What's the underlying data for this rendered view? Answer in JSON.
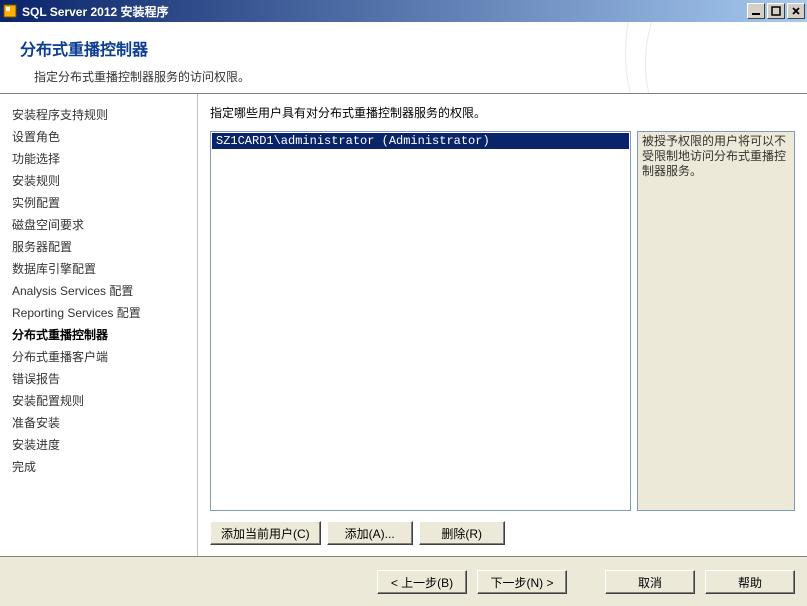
{
  "titlebar": {
    "title": "SQL Server 2012 安装程序"
  },
  "header": {
    "title": "分布式重播控制器",
    "subtitle": "指定分布式重播控制器服务的访问权限。"
  },
  "sidebar": {
    "items": [
      {
        "label": "安装程序支持规则",
        "active": false
      },
      {
        "label": "设置角色",
        "active": false
      },
      {
        "label": "功能选择",
        "active": false
      },
      {
        "label": "安装规则",
        "active": false
      },
      {
        "label": "实例配置",
        "active": false
      },
      {
        "label": "磁盘空间要求",
        "active": false
      },
      {
        "label": "服务器配置",
        "active": false
      },
      {
        "label": "数据库引擎配置",
        "active": false
      },
      {
        "label": "Analysis Services 配置",
        "active": false
      },
      {
        "label": "Reporting Services 配置",
        "active": false
      },
      {
        "label": "分布式重播控制器",
        "active": true
      },
      {
        "label": "分布式重播客户端",
        "active": false
      },
      {
        "label": "错误报告",
        "active": false
      },
      {
        "label": "安装配置规则",
        "active": false
      },
      {
        "label": "准备安装",
        "active": false
      },
      {
        "label": "安装进度",
        "active": false
      },
      {
        "label": "完成",
        "active": false
      }
    ]
  },
  "content": {
    "instruction": "指定哪些用户具有对分布式重播控制器服务的权限。",
    "userList": [
      {
        "text": "SZ1CARD1\\administrator (Administrator)",
        "selected": true
      }
    ],
    "infoText": "被授予权限的用户将可以不受限制地访问分布式重播控制器服务。",
    "buttons": {
      "addCurrentUser": "添加当前用户(C)",
      "add": "添加(A)...",
      "remove": "删除(R)"
    }
  },
  "footer": {
    "back": "< 上一步(B)",
    "next": "下一步(N) >",
    "cancel": "取消",
    "help": "帮助"
  }
}
